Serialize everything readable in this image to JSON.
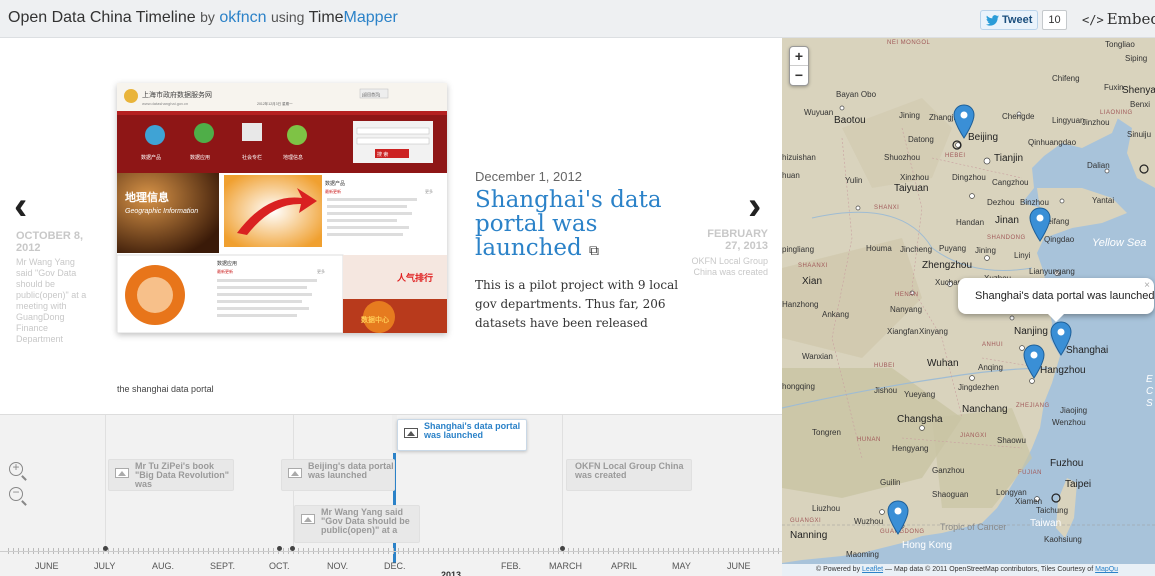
{
  "header": {
    "title_main": "Open Data China Timeline",
    "title_by": "by",
    "title_author": "okfncn",
    "title_using": "using",
    "title_tool_a": "Time",
    "title_tool_b": "Mapper",
    "tweet_label": "Tweet",
    "tweet_count": "10",
    "embed_icon": "</>",
    "embed_label": "Embed"
  },
  "story": {
    "prev_date": "OCTOBER 8, 2012",
    "prev_text": "Mr Wang Yang said \"Gov Data should be public(open)\" at a meeting with GuangDong Finance Department",
    "next_date": "FEBRUARY 27, 2013",
    "next_text": "OKFN Local Group China was created",
    "date": "December 1, 2012",
    "headline": "Shanghai's data portal was launched",
    "description": "This is a pilot project with 9 local gov departments. Thus far, 206 datasets have been released",
    "caption": "the shanghai data portal"
  },
  "portal_image": {
    "site_title": "上海市政府数据服务网",
    "site_url": "www.datashanghai.gov.cn",
    "search_btn": "搜 索",
    "banner_icons": [
      "数据产品",
      "数据应用",
      "社会专栏",
      "地理信息"
    ],
    "geo_cn": "地理信息",
    "geo_en": "Geographic Information",
    "data_products_title": "数据产品",
    "data_products_sub": "最新更新",
    "data_apps_title": "数据应用",
    "data_apps_sub": "最新更新",
    "popular": "人气排行",
    "data_center": "数据中心",
    "more": "更多",
    "header_badge": "[返回首页]",
    "date_line": "2012年12月3日 星期一"
  },
  "timeline": {
    "markers": [
      {
        "title": "Shanghai's data portal was launched",
        "active": true
      },
      {
        "title": "Mr Tu ZiPei's book \"Big Data Revolution\" was",
        "active": false
      },
      {
        "title": "Beijing's data portal was launched",
        "active": false
      },
      {
        "title": "OKFN Local Group China was created",
        "active": false
      },
      {
        "title": "Mr Wang Yang said \"Gov Data should be public(open)\" at a",
        "active": false
      }
    ],
    "months": [
      "JUNE",
      "JULY",
      "AUG.",
      "SEPT.",
      "OCT.",
      "NOV.",
      "DEC.",
      "FEB.",
      "MARCH",
      "APRIL",
      "MAY",
      "JUNE"
    ],
    "year": "2013"
  },
  "map": {
    "zoom_in": "+",
    "zoom_out": "−",
    "popup_text": "Shanghai's data portal was launched",
    "popup_close": "×",
    "attribution_a": "© Powered by",
    "attribution_leaflet": "Leaflet",
    "attribution_b": "— Map data © 2011 OpenStreetMap contributors, Tiles Courtesy of",
    "attribution_mapquest": "MapQu",
    "labels": {
      "nei_mongol": "NEI MONGOL",
      "tongliao": "Tongliao",
      "siping": "Siping",
      "chifeng": "Chifeng",
      "fuxin": "Fuxin",
      "shenyang": "Shenyang",
      "benxi": "Benxi",
      "liaoning": "LIAONING",
      "bayan_obo": "Bayan Obo",
      "wuyuan": "Wuyuan",
      "baotou": "Baotou",
      "jining": "Jining",
      "zhangjiakou": "Zhangjiak",
      "chengde": "Chengde",
      "lingyuan": "Lingyuan",
      "jinzhou": "Jinzhou",
      "sinuiju": "Sinuiju",
      "datong": "Datong",
      "beijing": "Beijing",
      "qinhuangdao": "Qinhuangdao",
      "hohhot": "hizuishan",
      "shuozhou": "Shuozhou",
      "hebei": "HEBEI",
      "tianjin": "Tianjin",
      "dalian": "Dalian",
      "yuan": "huan",
      "yulin": "Yulin",
      "xinzhou": "Xinzhou",
      "taiyuan": "Taiyuan",
      "dingzhou": "Dingzhou",
      "cangzhou": "Cangzhou",
      "shanxi": "SHANXI",
      "dezhou": "Dezhou",
      "binzhou": "Binzhou",
      "yantai": "Yantai",
      "weifang": "Weifang",
      "handan": "Handan",
      "jinan": "Jinan",
      "qingdao": "Qingdao",
      "shandong": "SHANDONG",
      "yellow_sea": "Yellow Sea",
      "pingliang": "pingliang",
      "houma": "Houma",
      "jincheng": "Jincheng",
      "puyang": "Puyang",
      "jining2": "Jining",
      "linyi": "Linyi",
      "shaanxi": "SHAANXI",
      "zhengzhou": "Zhengzhou",
      "lianyungang": "Lianyungang",
      "xian": "Xian",
      "xuchang": "Xuchang",
      "henan": "HENAN",
      "xuzhou": "Xuzhou",
      "hanzhong": "Hanzhong",
      "ankang": "Ankang",
      "nanyang": "Nanyang",
      "xiangfan": "Xiangfan",
      "xinyang": "Xinyang",
      "nanjing": "Nanjing",
      "shanghai": "Shanghai",
      "anhui": "ANHUI",
      "wanxian": "Wanxian",
      "hubei": "HUBEI",
      "wuhan": "Wuhan",
      "anqing": "Anqing",
      "hangzhou": "Hangzhou",
      "chongqing": "hongqing",
      "jishou": "Jishou",
      "yueyang": "Yueyang",
      "jingdezhen": "Jingdezhen",
      "nanchang": "Nanchang",
      "zhejiang": "ZHEJIANG",
      "jiaojing": "Jiaojing",
      "changsha": "Changsha",
      "wenzhou": "Wenzhou",
      "tongren": "Tongren",
      "hunan": "HUNAN",
      "jiangxi": "JIANGXI",
      "shaowu": "Shaowu",
      "hengyang": "Hengyang",
      "fuzhou": "Fuzhou",
      "guilin": "Guilin",
      "ganzhou": "Ganzhou",
      "fujian": "FUJIAN",
      "taipei": "Taipei",
      "shaoguan": "Shaoguan",
      "longyan": "Longyan",
      "xiamen": "Xiamen",
      "taichung": "Taichung",
      "liuzhou": "Liuzhou",
      "guangxi": "GUANGXI",
      "wuzhou": "Wuzhou",
      "tropic": "Tropic of Cancer",
      "taiwan": "Taiwan",
      "nanning": "Nanning",
      "guangdong": "GUANGDONG",
      "kaohsiung": "Kaohsiung",
      "hong_kong": "Hong Kong",
      "maoming": "Maoming",
      "edge_b": "E",
      "edge_c": "C",
      "edge_s": "S"
    }
  },
  "colors": {
    "accent": "#2b82c8",
    "marker_blue": "#3a8fd6",
    "marker_dark": "#222222"
  }
}
